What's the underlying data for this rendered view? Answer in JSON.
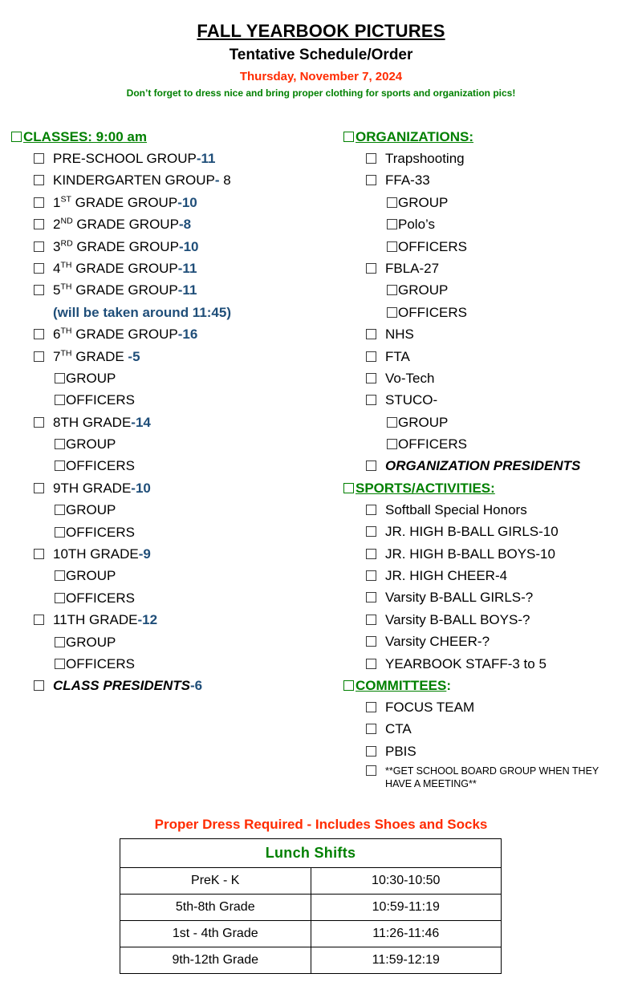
{
  "header": {
    "title": "FALL YEARBOOK PICTURES",
    "subtitle": "Tentative Schedule/Order",
    "date": "Thursday, November 7, 2024",
    "note": "Don’t forget to dress nice and bring proper clothing for sports and organization pics!"
  },
  "colors": {
    "green": "#008000",
    "red": "#ff2b00",
    "blue": "#1f4e79",
    "black": "#000000"
  },
  "left": {
    "section": {
      "label": "CLASSES: 9:00 am",
      "tail": ""
    },
    "items": [
      {
        "kind": "main",
        "text": "PRE-SCHOOL GROUP",
        "num": "-11"
      },
      {
        "kind": "main",
        "text": "KINDERGARTEN GROUP",
        "num": "-",
        "after": " 8"
      },
      {
        "kind": "main",
        "text": "1",
        "sup": "ST",
        "text2": " GRADE GROUP",
        "num": "-10"
      },
      {
        "kind": "main",
        "text": "2",
        "sup": "ND",
        "text2": " GRADE GROUP",
        "num": "-8"
      },
      {
        "kind": "main",
        "text": "3",
        "sup": "RD",
        "text2": " GRADE GROUP",
        "num": "-10"
      },
      {
        "kind": "main",
        "text": "4",
        "sup": "TH",
        "text2": " GRADE GROUP",
        "num": "-11"
      },
      {
        "kind": "main",
        "text": "5",
        "sup": "TH",
        "text2": " GRADE GROUP",
        "num": "-11"
      },
      {
        "kind": "note",
        "text": "(will be taken around 11:45)"
      },
      {
        "kind": "main",
        "text": "6",
        "sup": "TH",
        "text2": " GRADE GROUP",
        "num": "-16"
      },
      {
        "kind": "main",
        "text": "7",
        "sup": "TH",
        "text2": " GRADE ",
        "num": "-5"
      },
      {
        "kind": "sub",
        "text": "GROUP"
      },
      {
        "kind": "sub",
        "text": "OFFICERS"
      },
      {
        "kind": "main",
        "text": "8TH GRADE",
        "num": "-14"
      },
      {
        "kind": "sub",
        "text": "GROUP"
      },
      {
        "kind": "sub",
        "text": "OFFICERS"
      },
      {
        "kind": "main",
        "text": "9TH GRADE",
        "num": "-10"
      },
      {
        "kind": "sub",
        "text": "GROUP"
      },
      {
        "kind": "sub",
        "text": "OFFICERS"
      },
      {
        "kind": "main",
        "text": "10TH GRADE",
        "num": "-9"
      },
      {
        "kind": "sub",
        "text": "GROUP"
      },
      {
        "kind": "sub",
        "text": "OFFICERS"
      },
      {
        "kind": "main",
        "text": "11TH GRADE",
        "num": "-12"
      },
      {
        "kind": "sub",
        "text": "GROUP"
      },
      {
        "kind": "sub",
        "text": "OFFICERS"
      },
      {
        "kind": "main",
        "bolditalic": true,
        "text": "CLASS PRESIDENTS",
        "num": "-6"
      }
    ]
  },
  "right": {
    "sections": [
      {
        "section": {
          "label": "ORGANIZATIONS:",
          "tail": ""
        },
        "items": [
          {
            "kind": "main",
            "text": "Trapshooting"
          },
          {
            "kind": "main",
            "text": "FFA-33"
          },
          {
            "kind": "sub",
            "text": "GROUP"
          },
          {
            "kind": "sub",
            "text": "Polo’s"
          },
          {
            "kind": "sub",
            "text": "OFFICERS"
          },
          {
            "kind": "main",
            "text": "FBLA-27"
          },
          {
            "kind": "sub",
            "text": "GROUP"
          },
          {
            "kind": "sub",
            "text": "OFFICERS"
          },
          {
            "kind": "main",
            "text": "NHS"
          },
          {
            "kind": "main",
            "text": "FTA"
          },
          {
            "kind": "main",
            "text": "Vo-Tech"
          },
          {
            "kind": "main",
            "text": "STUCO-"
          },
          {
            "kind": "sub",
            "text": "GROUP"
          },
          {
            "kind": "sub",
            "text": "OFFICERS"
          },
          {
            "kind": "main",
            "bolditalic": true,
            "text": "ORGANIZATION PRESIDENTS"
          }
        ]
      },
      {
        "section": {
          "label": "SPORTS/ACTIVITIES:",
          "tail": ""
        },
        "items": [
          {
            "kind": "main",
            "text": "Softball Special Honors"
          },
          {
            "kind": "main",
            "text": "JR. HIGH B-BALL GIRLS-10"
          },
          {
            "kind": "main",
            "text": "JR. HIGH B-BALL BOYS-10"
          },
          {
            "kind": "main",
            "text": "JR. HIGH CHEER-4"
          },
          {
            "kind": "main",
            "text": "Varsity B-BALL GIRLS-?"
          },
          {
            "kind": "main",
            "text": "Varsity B-BALL BOYS-?"
          },
          {
            "kind": "main",
            "text": "Varsity CHEER-?"
          },
          {
            "kind": "main",
            "text": "YEARBOOK STAFF-3 to 5"
          }
        ]
      },
      {
        "section": {
          "label": "COMMITTEES",
          "tail": ":"
        },
        "items": [
          {
            "kind": "main",
            "text": "FOCUS TEAM"
          },
          {
            "kind": "main",
            "text": "CTA"
          },
          {
            "kind": "main",
            "text": "PBIS"
          },
          {
            "kind": "small",
            "text": "**GET SCHOOL BOARD GROUP WHEN THEY HAVE A MEETING**"
          }
        ]
      }
    ]
  },
  "footer": {
    "dress_note": "Proper Dress Required - Includes Shoes and Socks",
    "table": {
      "title": "Lunch Shifts",
      "rows": [
        {
          "grades": "PreK - K",
          "time": "10:30-10:50"
        },
        {
          "grades": "5th-8th Grade",
          "time": "10:59-11:19"
        },
        {
          "grades": "1st - 4th Grade",
          "time": "11:26-11:46"
        },
        {
          "grades": "9th-12th Grade",
          "time": "11:59-12:19"
        }
      ]
    }
  }
}
